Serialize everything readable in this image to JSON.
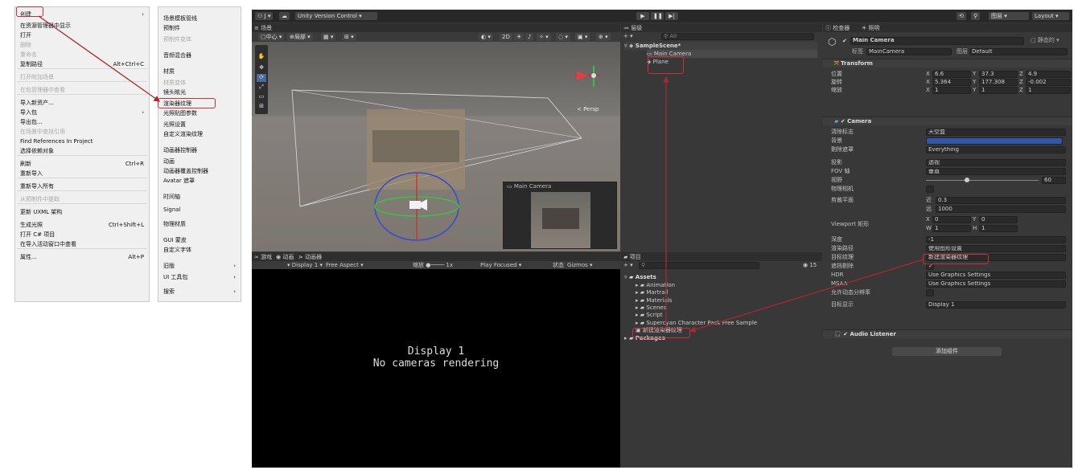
{
  "context_menu": {
    "items": [
      {
        "label": "创建",
        "sc": "",
        "dis": false,
        "arrow": true
      },
      {
        "label": "在资源管理器中显示",
        "sc": "",
        "dis": false
      },
      {
        "label": "打开",
        "sc": "",
        "dis": false
      },
      {
        "label": "删除",
        "sc": "",
        "dis": true
      },
      {
        "label": "重命名",
        "sc": "",
        "dis": true
      },
      {
        "label": "复制路径",
        "sc": "Alt+Ctrl+C",
        "dis": false
      },
      {
        "label": "打开附加场景",
        "sc": "",
        "dis": true
      },
      {
        "label": "在包管理器中查看",
        "sc": "",
        "dis": true
      },
      {
        "label": "导入新资产...",
        "sc": "",
        "dis": false
      },
      {
        "label": "导入包",
        "sc": "",
        "dis": false,
        "arrow": true
      },
      {
        "label": "导出包...",
        "sc": "",
        "dis": false
      },
      {
        "label": "在场景中查找引用",
        "sc": "",
        "dis": true
      },
      {
        "label": "Find References In Project",
        "sc": "",
        "dis": false
      },
      {
        "label": "选择依赖对象",
        "sc": "",
        "dis": false
      },
      {
        "label": "刷新",
        "sc": "Ctrl+R",
        "dis": false
      },
      {
        "label": "重新导入",
        "sc": "",
        "dis": false
      },
      {
        "label": "重新导入所有",
        "sc": "",
        "dis": false
      },
      {
        "label": "从预制件中提取",
        "sc": "",
        "dis": true
      },
      {
        "label": "更新 UXML 架构",
        "sc": "",
        "dis": false
      },
      {
        "label": "生成光照",
        "sc": "Ctrl+Shift+L",
        "dis": false
      },
      {
        "label": "打开 C# 项目",
        "sc": "",
        "dis": false
      },
      {
        "label": "在导入活动窗口中查看",
        "sc": "",
        "dis": false
      },
      {
        "label": "属性...",
        "sc": "Alt+P",
        "dis": false
      }
    ]
  },
  "submenu": {
    "items": [
      {
        "label": "场景模板管线",
        "dis": false
      },
      {
        "label": "预制件",
        "dis": false
      },
      {
        "label": "预制件变体",
        "dis": true
      },
      {
        "label": "音频混合器",
        "dis": false
      },
      {
        "label": "材质",
        "dis": false
      },
      {
        "label": "材质变体",
        "dis": true
      },
      {
        "label": "镜头眩光",
        "dis": false
      },
      {
        "label": "渲染器纹理",
        "dis": false
      },
      {
        "label": "光照贴图参数",
        "dis": false
      },
      {
        "label": "光照设置",
        "dis": false
      },
      {
        "label": "自定义渲染纹理",
        "dis": false
      },
      {
        "label": "动画器控制器",
        "dis": false
      },
      {
        "label": "动画",
        "dis": false
      },
      {
        "label": "动画器覆盖控制器",
        "dis": false
      },
      {
        "label": "Avatar 遮罩",
        "dis": false
      },
      {
        "label": "时间轴",
        "dis": false
      },
      {
        "label": "Signal",
        "dis": false
      },
      {
        "label": "物理材质",
        "dis": false
      },
      {
        "label": "GUI 蒙皮",
        "dis": false
      },
      {
        "label": "自定义字体",
        "dis": false
      },
      {
        "label": "旧版",
        "dis": false,
        "arrow": true
      },
      {
        "label": "UI 工具包",
        "dis": false,
        "arrow": true
      },
      {
        "label": "搜索",
        "dis": false,
        "arrow": true
      }
    ]
  },
  "toolbar": {
    "account": "J",
    "version_control": "Unity Version Control",
    "search": "图层",
    "layout": "Layout"
  },
  "scene": {
    "tab": "场景",
    "center": "中心",
    "local": "局部",
    "persp": "< Persp",
    "two_d": "2D",
    "cam_preview": "Main Camera"
  },
  "game": {
    "tab_game": "游戏",
    "tab_anim": "动画",
    "tab_animator": "动画器",
    "display": "Display 1",
    "aspect": "Free Aspect",
    "scale_label": "缩放",
    "scale": "1x",
    "play_focused": "Play Focused",
    "stats": "状态",
    "gizmos": "Gizmos",
    "msg1": "Display 1",
    "msg2": "No cameras rendering"
  },
  "hierarchy": {
    "tab": "层级",
    "search": "All",
    "scene": "SampleScene*",
    "items": [
      "Main Camera",
      "Plane"
    ]
  },
  "project": {
    "tab": "项目",
    "count": "15",
    "root": "Assets",
    "folders": [
      "Animation",
      "Martrail",
      "Materials",
      "Scenes",
      "Script",
      "Supercyan Character Pack Free Sample"
    ],
    "new_item": "新建渲染器纹理",
    "packages": "Packages"
  },
  "inspector": {
    "tab": "检查器",
    "tab2": "照明",
    "name": "Main Camera",
    "static": "静态的",
    "tag_label": "标签",
    "tag": "MainCamera",
    "layer_label": "图层",
    "layer": "Default",
    "transform": {
      "title": "Transform",
      "pos_label": "位置",
      "rot_label": "旋转",
      "scale_label": "缩放",
      "pos": [
        "6.6",
        "37.3",
        "4.9"
      ],
      "rot": [
        "5.364",
        "177.308",
        "-0.002"
      ],
      "scale": [
        "1",
        "1",
        "1"
      ]
    },
    "camera": {
      "title": "Camera",
      "rows": [
        {
          "label": "清除标志",
          "value": "天空盒"
        },
        {
          "label": "背景",
          "value": ""
        },
        {
          "label": "剔除遮罩",
          "value": "Everything"
        },
        {
          "label": "投影",
          "value": "透视"
        },
        {
          "label": "FOV 轴",
          "value": "垂直"
        },
        {
          "label": "视野",
          "value": "60"
        },
        {
          "label": "物理相机",
          "value": ""
        },
        {
          "label": "剪裁平面",
          "value": ""
        },
        {
          "label": "Viewport 矩形",
          "value": ""
        },
        {
          "label": "深度",
          "value": "-1"
        },
        {
          "label": "渲染路径",
          "value": "使用图形设置"
        },
        {
          "label": "目标纹理",
          "value": "新建渲染器纹理"
        },
        {
          "label": "遮挡剔除",
          "value": ""
        },
        {
          "label": "HDR",
          "value": "Use Graphics Settings"
        },
        {
          "label": "MSAA",
          "value": "Use Graphics Settings"
        },
        {
          "label": "允许动态分辨率",
          "value": ""
        },
        {
          "label": "目标显示",
          "value": "Display 1"
        }
      ],
      "near_label": "近",
      "near": "0.3",
      "far_label": "远",
      "far": "1000",
      "vp": {
        "x": "0",
        "y": "0",
        "w": "1",
        "h": "1"
      }
    },
    "audio": {
      "title": "Audio Listener"
    },
    "add_component": "添加组件"
  },
  "colors": {
    "highlight": "#c8303a",
    "unity_bg": "#383838",
    "bg_color": "#3256a8"
  }
}
